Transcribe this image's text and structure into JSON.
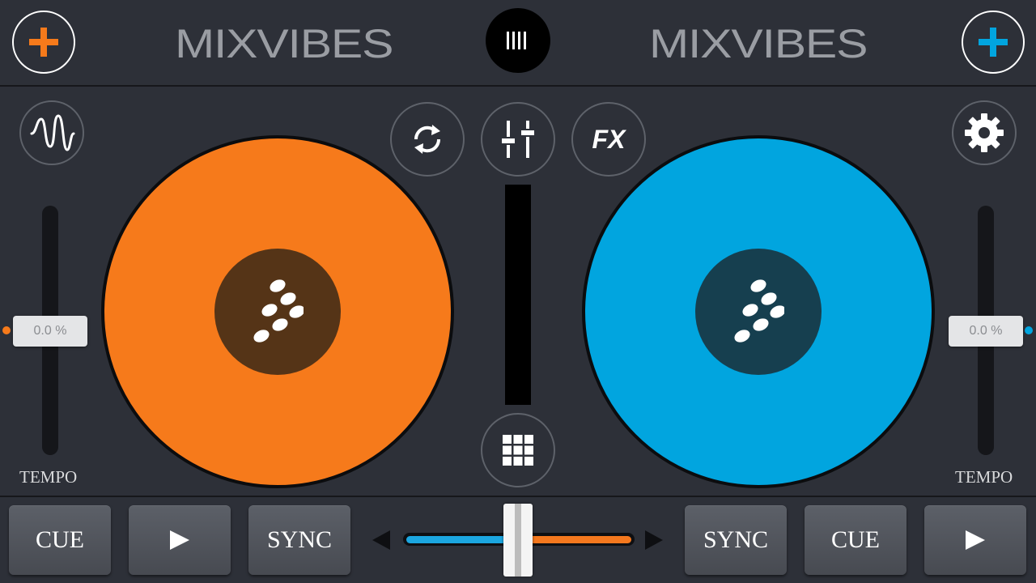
{
  "header": {
    "left_brand": "MIXVIBES",
    "right_brand": "MIXVIBES"
  },
  "colors": {
    "deck_a": "#f67a1b",
    "deck_b": "#01a5df",
    "deck_a_label": "#553417",
    "deck_b_label": "#163f4f",
    "background": "#2d3038"
  },
  "icons": {
    "add_left": "plus-icon",
    "add_right": "plus-icon",
    "library": "library-bars-icon",
    "waveform": "waveform-icon",
    "loop": "loop-icon",
    "mixer": "mixer-sliders-icon",
    "fx": "fx-icon",
    "settings": "gear-icon",
    "sampler": "grid-icon"
  },
  "center": {
    "fx_label": "FX"
  },
  "deck_a": {
    "tempo_value": "0.0 %",
    "tempo_label": "TEMPO",
    "cue_label": "CUE",
    "sync_label": "SYNC"
  },
  "deck_b": {
    "tempo_value": "0.0 %",
    "tempo_label": "TEMPO",
    "cue_label": "CUE",
    "sync_label": "SYNC"
  },
  "crossfader": {
    "position": 0.5
  }
}
